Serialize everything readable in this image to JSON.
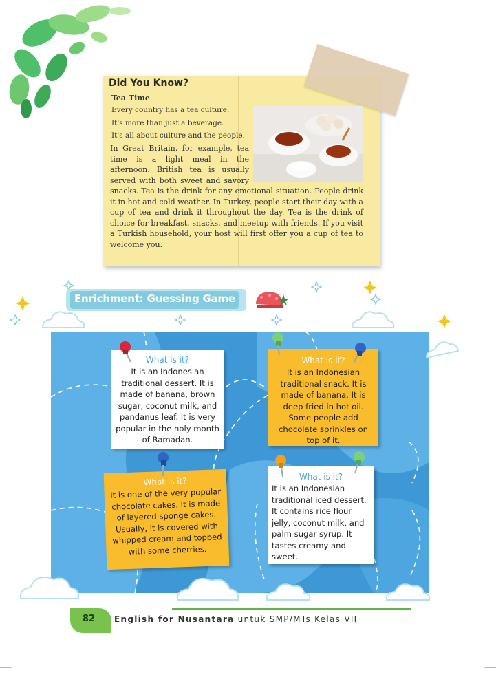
{
  "did_you_know": {
    "title": "Did You  Know?",
    "subtitle": "Tea Time",
    "lines": [
      "Every country has a tea culture.",
      "It's more than just a beverage.",
      "It's all about culture and the people."
    ],
    "body": "In Great Britain, for example, tea time is a light meal in the afternoon. British tea is usually served with both sweet and savory snacks. Tea is the drink for any emotional situation. People drink it in hot and cold weather. In Turkey, people start their day with a cup of tea and drink it throughout the day. Tea is the drink of choice for breakfast, snacks, and meetup with friends. If you visit a Turkish household, your host will first offer you a cup of tea to welcome you."
  },
  "section": {
    "title": "Enrichment: Guessing Game"
  },
  "notes": [
    {
      "question": "What is it?",
      "text": "It is an Indonesian traditional dessert. It is made of banana, brown sugar, coconut milk, and pandanus leaf. It is very popular in the holy month of Ramadan.",
      "color": "#ffffff",
      "pin_color": "#d8263a"
    },
    {
      "question": "What is it?",
      "text": "It is an Indonesian traditional snack. It is made of banana. It is deep fried in hot oil. Some people add chocolate sprinkles on top of it.",
      "color": "#f8bc2c",
      "pin_color": "#2f66c4"
    },
    {
      "question": "What is it?",
      "text": "It is one of the very popular chocolate cakes. It is made of layered sponge cakes. Usually, it is covered with whipped cream and topped with some cherries.",
      "color": "#f8bc2c",
      "pin_color": "#2f66c4"
    },
    {
      "question": "What is it?",
      "text": "It is an Indonesian traditional iced dessert. It contains rice flour jelly, coconut milk, and palm sugar syrup. It tastes creamy and sweet.",
      "color": "#ffffff",
      "pin_color": "#f0a020"
    }
  ],
  "footer": {
    "page_number": "82",
    "book_title": "English for Nusantara",
    "book_subtitle": " untuk SMP/MTs Kelas VII"
  },
  "colors": {
    "map_sea": "#3f98d6",
    "map_land": "#5eb1e6",
    "note_yellow": "#f8bc2c",
    "dyk_paper": "#f8eaa0",
    "leaf_green": "#4fbf6a",
    "footer_green": "#5fb44b"
  }
}
